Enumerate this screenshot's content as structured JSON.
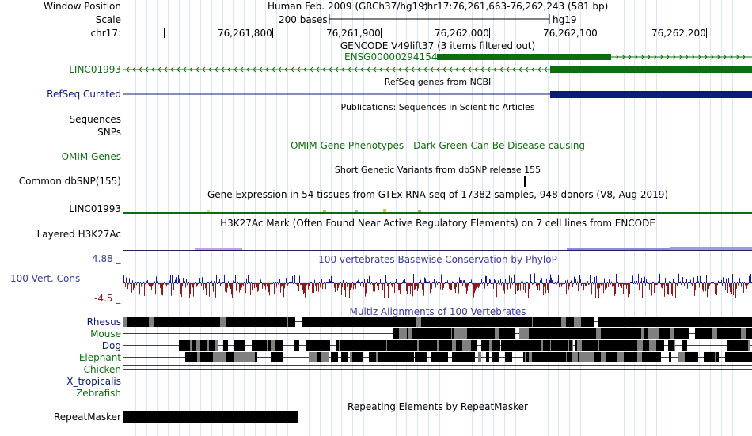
{
  "header": {
    "window_position_label": "Window Position",
    "scale_label": "Scale",
    "chrom_label": "chr17:",
    "assembly_text": "Human Feb. 2009 (GRCh37/hg19)",
    "position_text": "chr17:76,261,663-76,262,243 (581 bp)",
    "scale_text": "200 bases",
    "db_text": "hg19",
    "ruler_ticks": [
      "76,261,800",
      "76,261,900",
      "76,262,000",
      "76,262,100",
      "76,262,200"
    ]
  },
  "tracks": {
    "gencode": {
      "title": "GENCODE V49lift37 (3 items filtered out)",
      "item_label": "ENSG00000294154",
      "side_label": "LINC01993",
      "color": "#0d6e0d"
    },
    "refseq": {
      "title": "RefSeq genes from NCBI",
      "side_label": "RefSeq Curated",
      "color": "#0c1a7a"
    },
    "publications": {
      "title": "Publications: Sequences in Scientific Articles",
      "side_label_1": "Sequences",
      "side_label_2": "SNPs"
    },
    "omim": {
      "title": "OMIM Gene Phenotypes - Dark Green Can Be Disease-causing",
      "side_label": "OMIM Genes",
      "color": "#0d6e0d"
    },
    "dbsnp": {
      "title": "Short Genetic Variants from dbSNP release 155",
      "side_label": "Common dbSNP(155)"
    },
    "gtex": {
      "title": "Gene Expression in 54 tissues from GTEx RNA-seq of 17382 samples, 948 donors (V8, Aug 2019)",
      "side_label": "LINC01993"
    },
    "h3k27ac": {
      "title": "H3K27Ac Mark (Often Found Near Active Regulatory Elements) on 7 cell lines from ENCODE",
      "side_label": "Layered H3K27Ac"
    },
    "phylop": {
      "title": "100 vertebrates Basewise Conservation by PhyloP",
      "side_label": "100 Vert. Cons",
      "max_label": "4.88 _",
      "min_label": "-4.5 _",
      "pos_color": "#1a1a8c",
      "neg_color": "#8c1a1a"
    },
    "multiz": {
      "title": "Multiz Alignments of 100 Vertebrates",
      "species": [
        {
          "name": "Rhesus",
          "color": "#0c1a7a"
        },
        {
          "name": "Mouse",
          "color": "#0d6e0d"
        },
        {
          "name": "Dog",
          "color": "#0c1a7a"
        },
        {
          "name": "Elephant",
          "color": "#0d6e0d"
        },
        {
          "name": "Chicken",
          "color": "#0d6e0d"
        },
        {
          "name": "X_tropicalis",
          "color": "#0c1a7a"
        },
        {
          "name": "Zebrafish",
          "color": "#0d6e0d"
        }
      ]
    },
    "repeatmasker": {
      "title": "Repeating Elements by RepeatMasker",
      "side_label": "RepeatMasker"
    }
  }
}
